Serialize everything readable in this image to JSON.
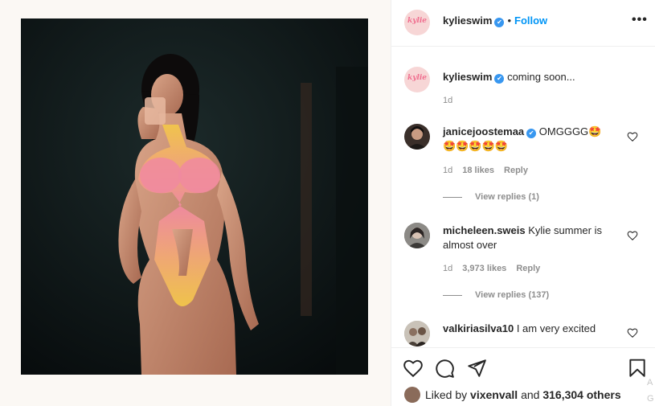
{
  "header": {
    "brand_mark": "kylie",
    "username": "kylieswim",
    "verified_mark": "✔",
    "separator": "•",
    "follow_label": "Follow",
    "more_icon": "more-horizontal-icon"
  },
  "caption": {
    "username": "kylieswim",
    "text": "coming soon...",
    "time": "1d"
  },
  "comments": [
    {
      "username": "janicejoostemaa",
      "text": "OMGGGG🤩",
      "text_line2": "🤩🤩🤩🤩🤩",
      "time": "1d",
      "likes": "18 likes",
      "reply_label": "Reply",
      "view_replies": "View replies (1)"
    },
    {
      "username": "micheleen.sweis",
      "text": "Kylie summer is",
      "text_line2": "almost over",
      "time": "1d",
      "likes": "3,973 likes",
      "reply_label": "Reply",
      "view_replies": "View replies (137)"
    },
    {
      "username": "valkiriasilva10",
      "text": "I am very excited"
    }
  ],
  "actions": {
    "liked_by_prefix": "Liked by",
    "liked_by_user": "vixenvall",
    "liked_by_and": "and",
    "liked_by_count": "316,304 others",
    "icons": [
      "heart-icon",
      "comment-icon",
      "share-icon",
      "bookmark-icon"
    ]
  },
  "edge_text": [
    "A",
    "G"
  ],
  "colors": {
    "accent": "#0095f6",
    "verified": "#3897f0",
    "text": "#262626",
    "secondary": "#8e8e8e",
    "border": "#efefef"
  }
}
